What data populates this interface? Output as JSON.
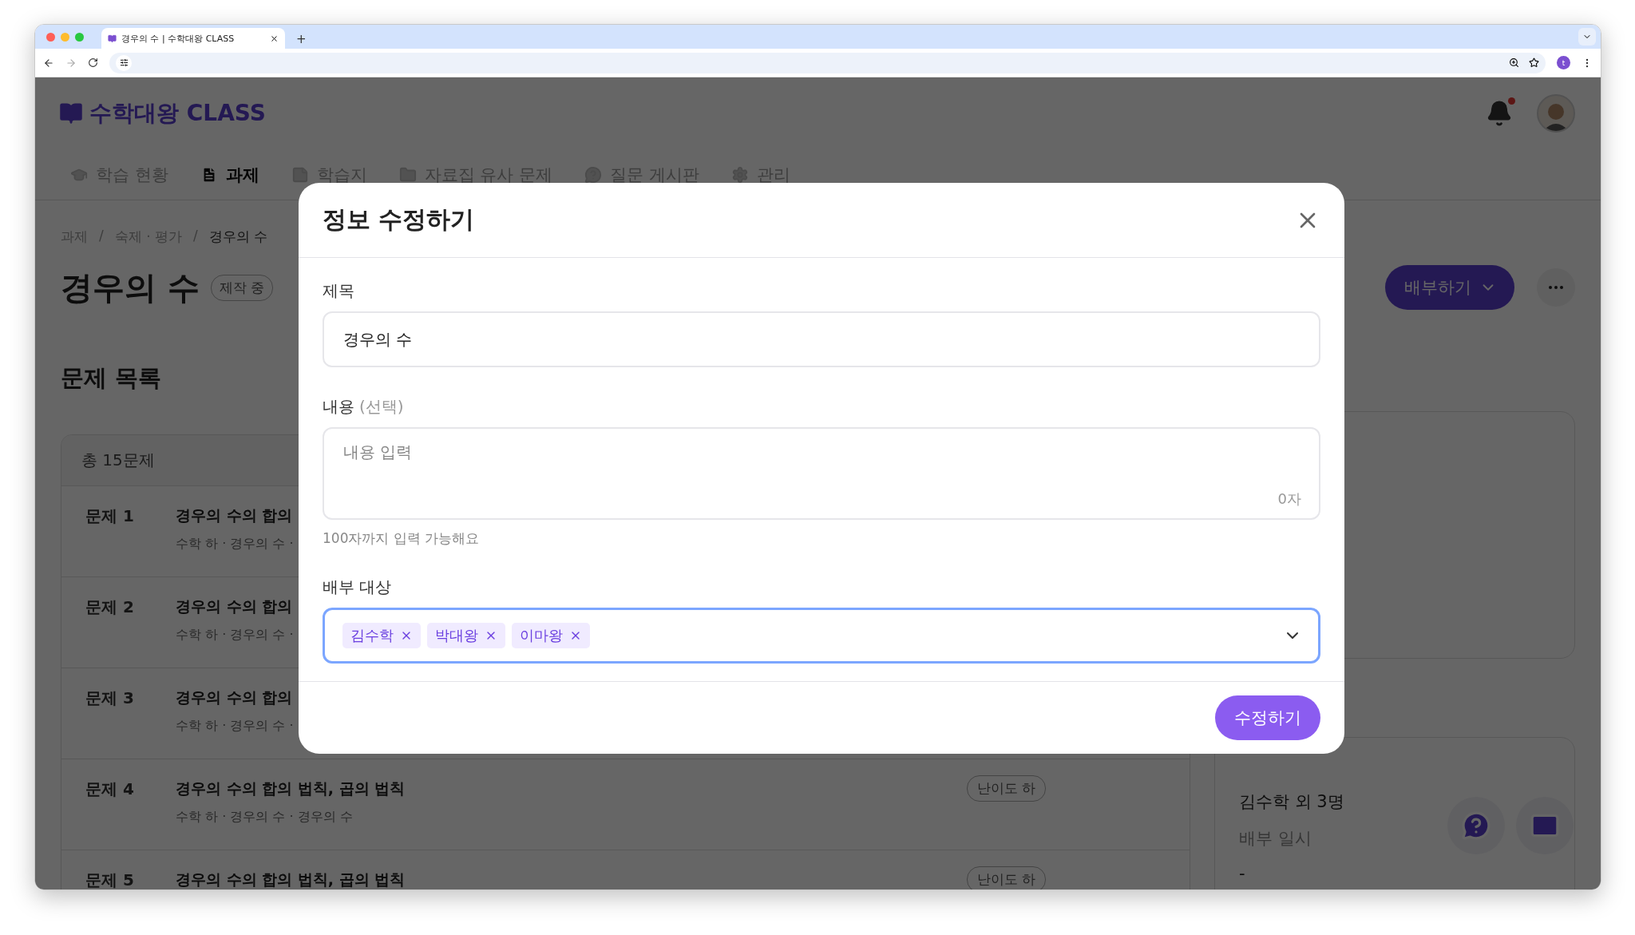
{
  "browser": {
    "tab_title": "경우의 수 | 수학대왕 CLASS",
    "new_tab": "+",
    "profile_initial": "t"
  },
  "header": {
    "logo": "수학대왕 CLASS",
    "notification_unread": true
  },
  "nav": [
    {
      "label": "학습 현황",
      "selected": false
    },
    {
      "label": "과제",
      "selected": true
    },
    {
      "label": "학습지",
      "selected": false
    },
    {
      "label": "자료집 유사 문제",
      "selected": false
    },
    {
      "label": "질문 게시판",
      "selected": false
    },
    {
      "label": "관리",
      "selected": false
    }
  ],
  "breadcrumb": {
    "items": [
      "과제",
      "숙제 · 평가",
      "경우의 수"
    ],
    "separator": "/"
  },
  "page": {
    "title": "경우의 수",
    "status": "제작 중",
    "distribute_button": "배부하기"
  },
  "problem_list": {
    "heading": "문제 목록",
    "total": "총 15문제",
    "rows": [
      {
        "number": "문제 1",
        "title": "경우의 수의 합의",
        "meta": "수학 하 · 경우의 수 ·"
      },
      {
        "number": "문제 2",
        "title": "경우의 수의 합의",
        "meta": "수학 하 · 경우의 수 ·"
      },
      {
        "number": "문제 3",
        "title": "경우의 수의 합의",
        "meta": "수학 하 · 경우의 수 ·"
      },
      {
        "number": "문제 4",
        "title": "경우의 수의 합의 법칙, 곱의 법칙",
        "meta": "수학 하 · 경우의 수 · 경우의 수",
        "difficulty": "난이도 하"
      },
      {
        "number": "문제 5",
        "title": "경우의 수의 합의 법칙, 곱의 법칙",
        "difficulty": "난이도 하"
      }
    ]
  },
  "distribution_panel": {
    "targets": "김수학 외 3명",
    "date_label": "배부 일시",
    "date_value": "-"
  },
  "modal": {
    "title": "정보 수정하기",
    "title_field": {
      "label": "제목",
      "value": "경우의 수"
    },
    "content_field": {
      "label": "내용",
      "label_note": "(선택)",
      "placeholder": "내용 입력",
      "counter": "0자",
      "helper": "100자까지 입력 가능해요"
    },
    "target_field": {
      "label": "배부 대상",
      "focused": true,
      "tags": [
        "김수학",
        "박대왕",
        "이마왕"
      ]
    },
    "submit": "수정하기"
  }
}
